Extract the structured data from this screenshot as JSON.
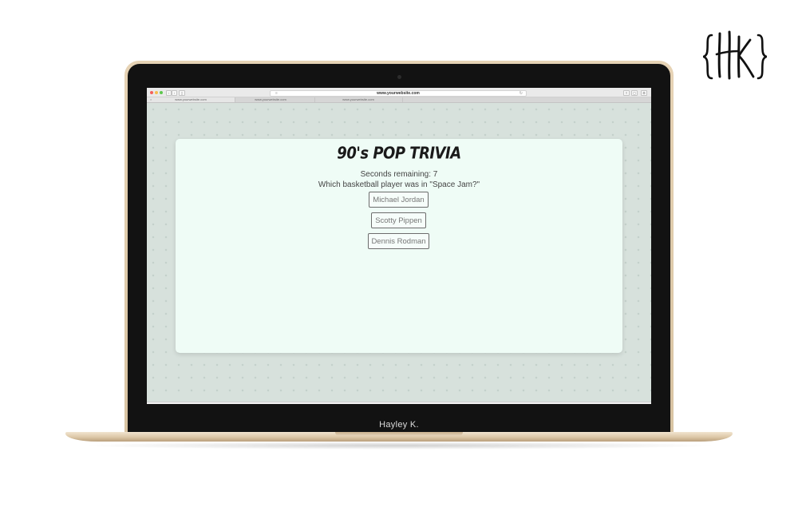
{
  "browser": {
    "address_url": "www.yourwebsite.com",
    "tabs": [
      {
        "label": "www.yourwebsite.com",
        "active": true
      },
      {
        "label": "www.yourwebsite.com",
        "active": false
      },
      {
        "label": "www.yourwebsite.com",
        "active": false
      }
    ]
  },
  "trivia": {
    "title": "90's POP TRIVIA",
    "timer_text": "Seconds remaining: 7",
    "question": "Which basketball player was in \"Space Jam?\"",
    "answers": [
      {
        "label": "Michael Jordan"
      },
      {
        "label": "Scotty Pippen"
      },
      {
        "label": "Dennis Rodman"
      }
    ]
  },
  "laptop": {
    "bezel_label": "Hayley K."
  },
  "logo": {
    "text": "{HK}"
  },
  "colors": {
    "card_background": "#effcf6",
    "page_background": "#d7e1dc",
    "laptop_gold": "#d8c3a2",
    "bezel": "#121212"
  }
}
